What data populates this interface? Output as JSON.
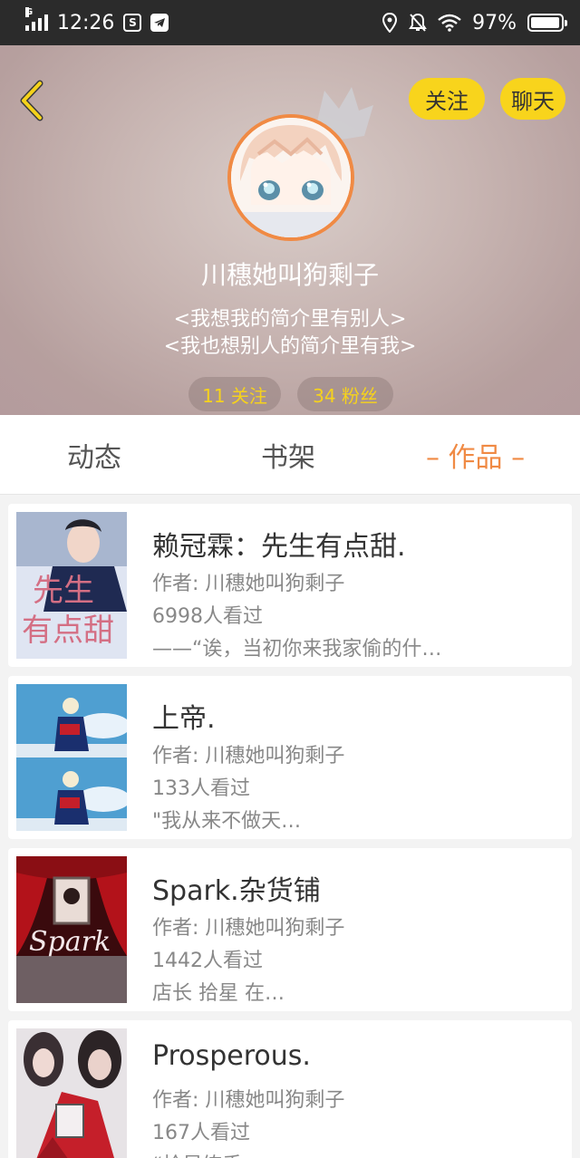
{
  "status_bar": {
    "network": "G",
    "time": "12:26",
    "battery_percent": "97%",
    "battery_level": 0.97
  },
  "profile": {
    "follow_button": "关注",
    "chat_button": "聊天",
    "username": "川穗她叫狗剩子",
    "bio_line1": "<我想我的简介里有别人>",
    "bio_line2": "<我也想别人的简介里有我>",
    "following": "11 关注",
    "fans": "34 粉丝"
  },
  "tabs": {
    "dynamic": "动态",
    "bookshelf": "书架",
    "works": "– 作品 –"
  },
  "works": [
    {
      "title": "赖冠霖：先生有点甜.",
      "author": "作者: 川穗她叫狗剩子",
      "views": "6998人看过",
      "excerpt": "——“诶，当初你来我家偷的什…",
      "cover_text": "先生有点甜",
      "cover_colors": [
        "#dfe5f2",
        "#1f2a52"
      ]
    },
    {
      "title": "上帝.",
      "author": "作者: 川穗她叫狗剩子",
      "views": "133人看过",
      "excerpt": "\"我从来不做天…",
      "cover_colors": [
        "#4f9fd1",
        "#1a2f6e"
      ]
    },
    {
      "title": "Spark.杂货铺",
      "author": "作者: 川穗她叫狗剩子",
      "views": "1442人看过",
      "excerpt": "店长  拾星  在…",
      "cover_text": "Spark",
      "cover_colors": [
        "#b3121a",
        "#3a0a0d"
      ]
    },
    {
      "title": "Prosperous.",
      "author": "作者: 川穗她叫狗剩子",
      "views": "167人看过",
      "excerpt": "“拾星练手…",
      "cover_colors": [
        "#e7e3e6",
        "#c51f2a"
      ]
    }
  ]
}
